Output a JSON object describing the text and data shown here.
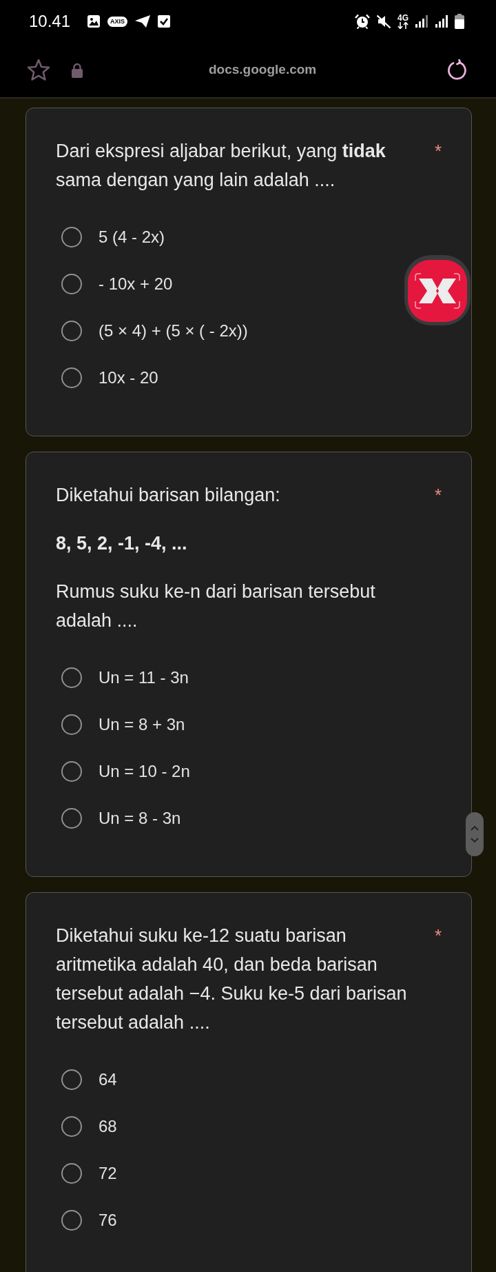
{
  "status_bar": {
    "time": "10.41",
    "carrier_badge": "AXIS",
    "network_type": "4G"
  },
  "address_bar": {
    "url": "docs.google.com"
  },
  "questions": [
    {
      "title": "Dari ekspresi aljabar berikut, yang **tidak** sama dengan yang lain adalah ....",
      "required_mark": "*",
      "options": [
        {
          "label": "5 (4 - 2x)",
          "selected": false
        },
        {
          "label": "- 10x + 20",
          "selected": false
        },
        {
          "label": "(5 × 4) + (5 × ( - 2x))",
          "selected": false
        },
        {
          "label": "10x - 20",
          "selected": false
        }
      ]
    },
    {
      "title": "Diketahui barisan bilangan:",
      "required_mark": "*",
      "sequence": "8, 5, 2, -1, -4, ...",
      "prompt": "Rumus suku ke-n dari barisan tersebut adalah ....",
      "options": [
        {
          "label": "Un = 11 - 3n",
          "selected": false
        },
        {
          "label": "Un = 8 + 3n",
          "selected": false
        },
        {
          "label": "Un = 10 - 2n",
          "selected": false
        },
        {
          "label": "Un = 8 - 3n",
          "selected": false
        }
      ]
    },
    {
      "title": "Diketahui suku ke-12 suatu barisan aritmetika adalah 40, dan beda barisan tersebut adalah −4. Suku ke-5 dari barisan tersebut adalah ....",
      "required_mark": "*",
      "options": [
        {
          "label": "64",
          "selected": false
        },
        {
          "label": "68",
          "selected": false
        },
        {
          "label": "72",
          "selected": false
        },
        {
          "label": "76",
          "selected": false
        }
      ]
    }
  ]
}
